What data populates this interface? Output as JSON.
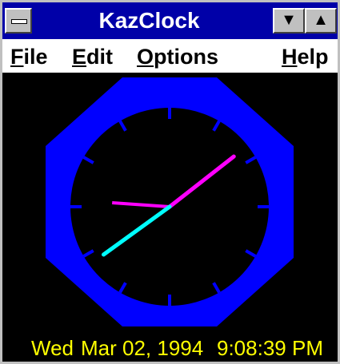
{
  "window": {
    "title": "KazClock"
  },
  "menu": {
    "items": [
      {
        "label": "File",
        "accel": "F",
        "rest": "ile"
      },
      {
        "label": "Edit",
        "accel": "E",
        "rest": "dit"
      },
      {
        "label": "Options",
        "accel": "O",
        "rest": "ptions"
      },
      {
        "label": "Help",
        "accel": "H",
        "rest": "elp"
      }
    ]
  },
  "clock": {
    "colors": {
      "face": "#0000ff",
      "dial": "#000000",
      "ticks": "#0000ff",
      "hour_hand": "#ff00ff",
      "minute_hand": "#ff00ff",
      "second_hand": "#00ffff"
    },
    "time": {
      "hour": 9,
      "minute": 8,
      "second": 39
    }
  },
  "status": {
    "day": "Wed",
    "date": "Mar 02, 1994",
    "time": "9:08:39 PM",
    "color": "#ffff00"
  }
}
